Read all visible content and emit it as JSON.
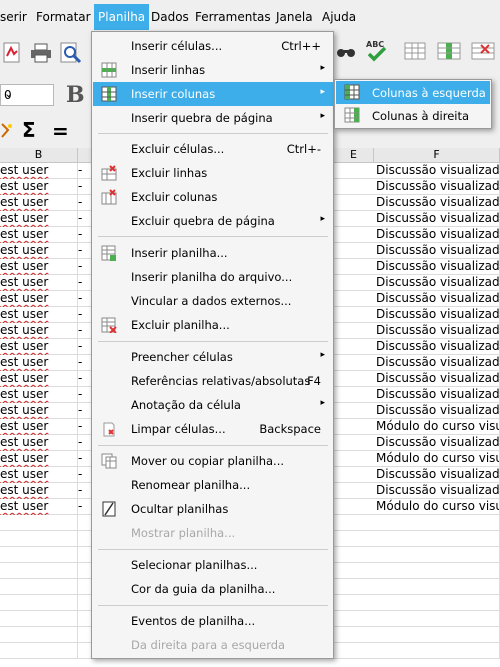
{
  "menubar": {
    "items": [
      {
        "label": "serir"
      },
      {
        "label": "Formatar"
      },
      {
        "label": "Planilha"
      },
      {
        "label": "Dados"
      },
      {
        "label": "Ferramentas"
      },
      {
        "label": "Janela"
      },
      {
        "label": "Ajuda"
      }
    ],
    "active_index": 2
  },
  "toolbar": {
    "font_size": "0",
    "bold_label": "B"
  },
  "columns": {
    "b": "B",
    "e": "E",
    "f": "F"
  },
  "rows": [
    {
      "b": "est user",
      "c": "-",
      "f": "Discussão visualizada"
    },
    {
      "b": "est user",
      "c": "-",
      "f": "Discussão visualizada"
    },
    {
      "b": "est user",
      "c": "-",
      "f": "Discussão visualizada"
    },
    {
      "b": "est user",
      "c": "-",
      "f": "Discussão visualizada"
    },
    {
      "b": "est user",
      "c": "-",
      "f": "Discussão visualizada"
    },
    {
      "b": "est user",
      "c": "-",
      "f": "Discussão visualizada"
    },
    {
      "b": "est user",
      "c": "-",
      "f": "Discussão visualizada"
    },
    {
      "b": "est user",
      "c": "-",
      "f": "Discussão visualizada"
    },
    {
      "b": "est user",
      "c": "-",
      "f": "Discussão visualizada"
    },
    {
      "b": "est user",
      "c": "-",
      "f": "Discussão visualizada"
    },
    {
      "b": "est user",
      "c": "-",
      "f": "Discussão visualizada"
    },
    {
      "b": "est user",
      "c": "-",
      "f": "Discussão visualizada"
    },
    {
      "b": "est user",
      "c": "-",
      "f": "Discussão visualizada"
    },
    {
      "b": "est user",
      "c": "-",
      "f": "Discussão visualizada"
    },
    {
      "b": "est user",
      "c": "-",
      "f": "Discussão visualizada"
    },
    {
      "b": "est user",
      "c": "-",
      "f": "Discussão visualizada"
    },
    {
      "b": "est user",
      "c": "-",
      "f": "Módulo do curso visu"
    },
    {
      "b": "est user",
      "c": "-",
      "f": "Discussão visualizada"
    },
    {
      "b": "est user",
      "c": "-",
      "f": "Módulo do curso visu"
    },
    {
      "b": "est user",
      "c": "-",
      "f": "Discussão visualizada"
    },
    {
      "b": "est user",
      "c": "-",
      "f": "Discussão visualizada"
    },
    {
      "b": "est user",
      "c": "-",
      "f": "Módulo do curso visu"
    }
  ],
  "planilha_menu": {
    "items": [
      {
        "label": "Inserir células...",
        "accel": "Ctrl++",
        "icon": "none"
      },
      {
        "label": "Inserir linhas",
        "submenu": true,
        "icon": "insert-rows-icon"
      },
      {
        "label": "Inserir colunas",
        "submenu": true,
        "highlighted": true,
        "icon": "insert-columns-icon"
      },
      {
        "label": "Inserir quebra de página",
        "submenu": true,
        "icon": "none"
      },
      {
        "label": "Excluir células...",
        "accel": "Ctrl+-",
        "icon": "none"
      },
      {
        "label": "Excluir linhas",
        "icon": "delete-rows-icon"
      },
      {
        "label": "Excluir colunas",
        "icon": "delete-columns-icon"
      },
      {
        "label": "Excluir quebra de página",
        "submenu": true,
        "icon": "none"
      },
      {
        "label": "Inserir planilha...",
        "icon": "insert-sheet-icon"
      },
      {
        "label": "Inserir planilha do arquivo...",
        "icon": "none"
      },
      {
        "label": "Vincular a dados externos...",
        "icon": "none"
      },
      {
        "label": "Excluir planilha...",
        "icon": "delete-sheet-icon"
      },
      {
        "label": "Preencher células",
        "submenu": true,
        "icon": "none"
      },
      {
        "label": "Referências relativas/absolutas",
        "accel": "F4",
        "icon": "none"
      },
      {
        "label": "Anotação da célula",
        "submenu": true,
        "icon": "none"
      },
      {
        "label": "Limpar células...",
        "accel": "Backspace",
        "icon": "clear-cells-icon"
      },
      {
        "label": "Mover ou copiar planilha...",
        "icon": "move-copy-sheet-icon"
      },
      {
        "label": "Renomear planilha...",
        "icon": "none"
      },
      {
        "label": "Ocultar planilhas",
        "icon": "hide-sheet-icon"
      },
      {
        "label": "Mostrar planilha...",
        "disabled": true,
        "icon": "none"
      },
      {
        "label": "Selecionar planilhas...",
        "icon": "none"
      },
      {
        "label": "Cor da guia da planilha...",
        "icon": "none"
      },
      {
        "label": "Eventos de planilha...",
        "icon": "none"
      },
      {
        "label": "Da direita para a esquerda",
        "disabled": true,
        "icon": "none"
      }
    ]
  },
  "columns_submenu": {
    "items": [
      {
        "label": "Colunas à esquerda",
        "highlighted": true,
        "icon": "columns-left-icon"
      },
      {
        "label": "Colunas à direita",
        "icon": "columns-right-icon"
      }
    ]
  },
  "colors": {
    "highlight": "#3daee9",
    "menu_bg": "#f5f5f5",
    "toolbar_bg": "#efefef"
  }
}
